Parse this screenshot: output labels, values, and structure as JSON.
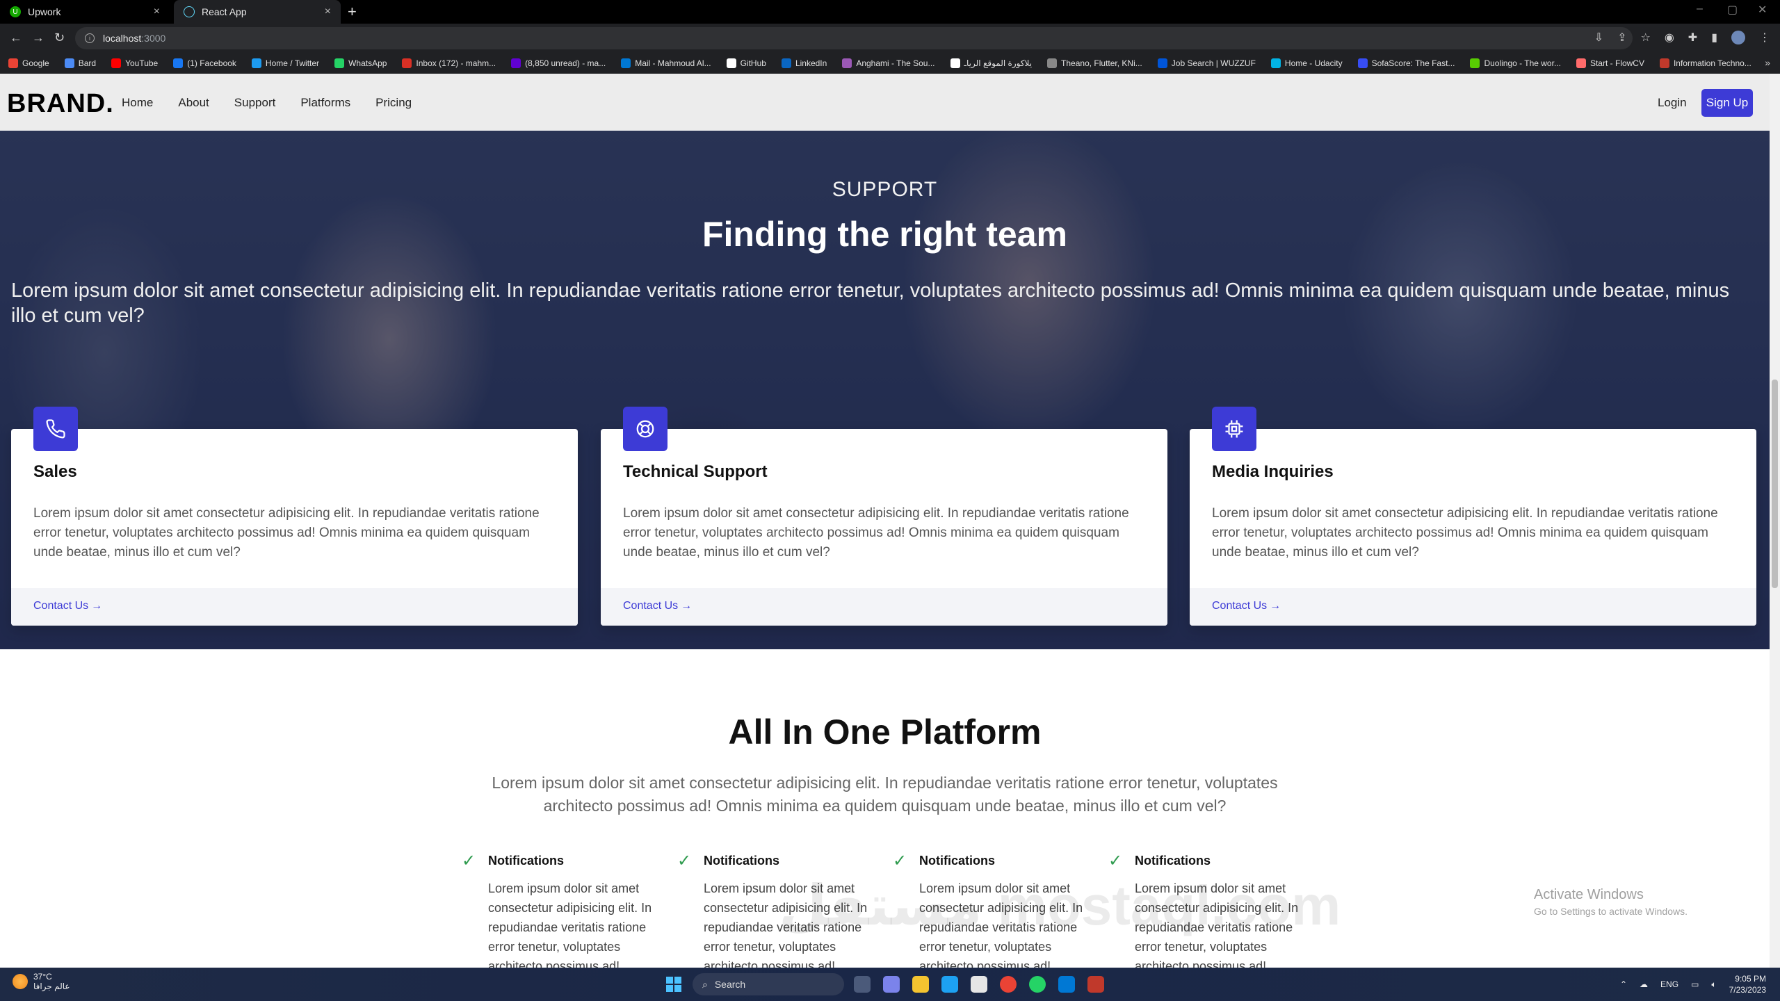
{
  "browser": {
    "tabs": [
      {
        "title": "Upwork"
      },
      {
        "title": "React App"
      }
    ],
    "url_host": "localhost",
    "url_port": ":3000",
    "bookmarks": [
      {
        "label": "Google",
        "color": "#ea4335"
      },
      {
        "label": "Bard",
        "color": "#4c8bf5"
      },
      {
        "label": "YouTube",
        "color": "#ff0000"
      },
      {
        "label": "(1) Facebook",
        "color": "#1877f2"
      },
      {
        "label": "Home / Twitter",
        "color": "#1d9bf0"
      },
      {
        "label": "WhatsApp",
        "color": "#25d366"
      },
      {
        "label": "Inbox (172) - mahm...",
        "color": "#d93025"
      },
      {
        "label": "(8,850 unread) - ma...",
        "color": "#6001d2"
      },
      {
        "label": "Mail - Mahmoud Al...",
        "color": "#0078d4"
      },
      {
        "label": "GitHub",
        "color": "#ffffff"
      },
      {
        "label": "LinkedIn",
        "color": "#0a66c2"
      },
      {
        "label": "Anghami - The Sou...",
        "color": "#9b59b6"
      },
      {
        "label": "يلاكورة الموقع الرياـ",
        "color": "#ffffff"
      },
      {
        "label": "Theano, Flutter, KNi...",
        "color": "#888888"
      },
      {
        "label": "Job Search | WUZZUF",
        "color": "#0055d9"
      },
      {
        "label": "Home - Udacity",
        "color": "#02b3e4"
      },
      {
        "label": "SofaScore: The Fast...",
        "color": "#374df5"
      },
      {
        "label": "Duolingo - The wor...",
        "color": "#58cc02"
      },
      {
        "label": "Start - FlowCV",
        "color": "#ff6b6b"
      },
      {
        "label": "Information Techno...",
        "color": "#c0392b"
      }
    ]
  },
  "nav": {
    "brand": "BRAND.",
    "links": [
      "Home",
      "About",
      "Support",
      "Platforms",
      "Pricing"
    ],
    "login": "Login",
    "signup": "Sign Up"
  },
  "hero": {
    "kicker": "SUPPORT",
    "title": "Finding the right team",
    "text": "Lorem ipsum dolor sit amet consectetur adipisicing elit. In repudiandae veritatis ratione error tenetur, voluptates architecto possimus ad! Omnis minima ea quidem quisquam unde beatae, minus illo et cum vel?"
  },
  "cards": [
    {
      "title": "Sales",
      "icon": "phone-icon",
      "text": "Lorem ipsum dolor sit amet consectetur adipisicing elit. In repudiandae veritatis ratione error tenetur, voluptates architecto possimus ad! Omnis minima ea quidem quisquam unde beatae, minus illo et cum vel?",
      "link": "Contact Us"
    },
    {
      "title": "Technical Support",
      "icon": "lifebuoy-icon",
      "text": "Lorem ipsum dolor sit amet consectetur adipisicing elit. In repudiandae veritatis ratione error tenetur, voluptates architecto possimus ad! Omnis minima ea quidem quisquam unde beatae, minus illo et cum vel?",
      "link": "Contact Us"
    },
    {
      "title": "Media Inquiries",
      "icon": "chip-icon",
      "text": "Lorem ipsum dolor sit amet consectetur adipisicing elit. In repudiandae veritatis ratione error tenetur, voluptates architecto possimus ad! Omnis minima ea quidem quisquam unde beatae, minus illo et cum vel?",
      "link": "Contact Us"
    }
  ],
  "platform": {
    "title": "All In One Platform",
    "text": "Lorem ipsum dolor sit amet consectetur adipisicing elit. In repudiandae veritatis ratione error tenetur, voluptates architecto possimus ad! Omnis minima ea quidem quisquam unde beatae, minus illo et cum vel?",
    "features": [
      {
        "title": "Notifications",
        "text": "Lorem ipsum dolor sit amet consectetur adipisicing elit. In repudiandae veritatis ratione error tenetur, voluptates architecto possimus ad! Omnis"
      },
      {
        "title": "Notifications",
        "text": "Lorem ipsum dolor sit amet consectetur adipisicing elit. In repudiandae veritatis ratione error tenetur, voluptates architecto possimus ad! Omnis"
      },
      {
        "title": "Notifications",
        "text": "Lorem ipsum dolor sit amet consectetur adipisicing elit. In repudiandae veritatis ratione error tenetur, voluptates architecto possimus ad! Omnis"
      },
      {
        "title": "Notifications",
        "text": "Lorem ipsum dolor sit amet consectetur adipisicing elit. In repudiandae veritatis ratione error tenetur, voluptates architecto possimus ad! Omnis"
      }
    ]
  },
  "overlay": {
    "activate_title": "Activate Windows",
    "activate_sub": "Go to Settings to activate Windows.",
    "watermark": "مستقل mostaql.com"
  },
  "taskbar": {
    "temp": "37°C",
    "weather_text": "عالم جرافا",
    "search": "Search",
    "lang": "ENG",
    "time": "9:05 PM",
    "date": "7/23/2023"
  },
  "colors": {
    "accent": "#3d3bd6",
    "check": "#2e9b4e"
  }
}
